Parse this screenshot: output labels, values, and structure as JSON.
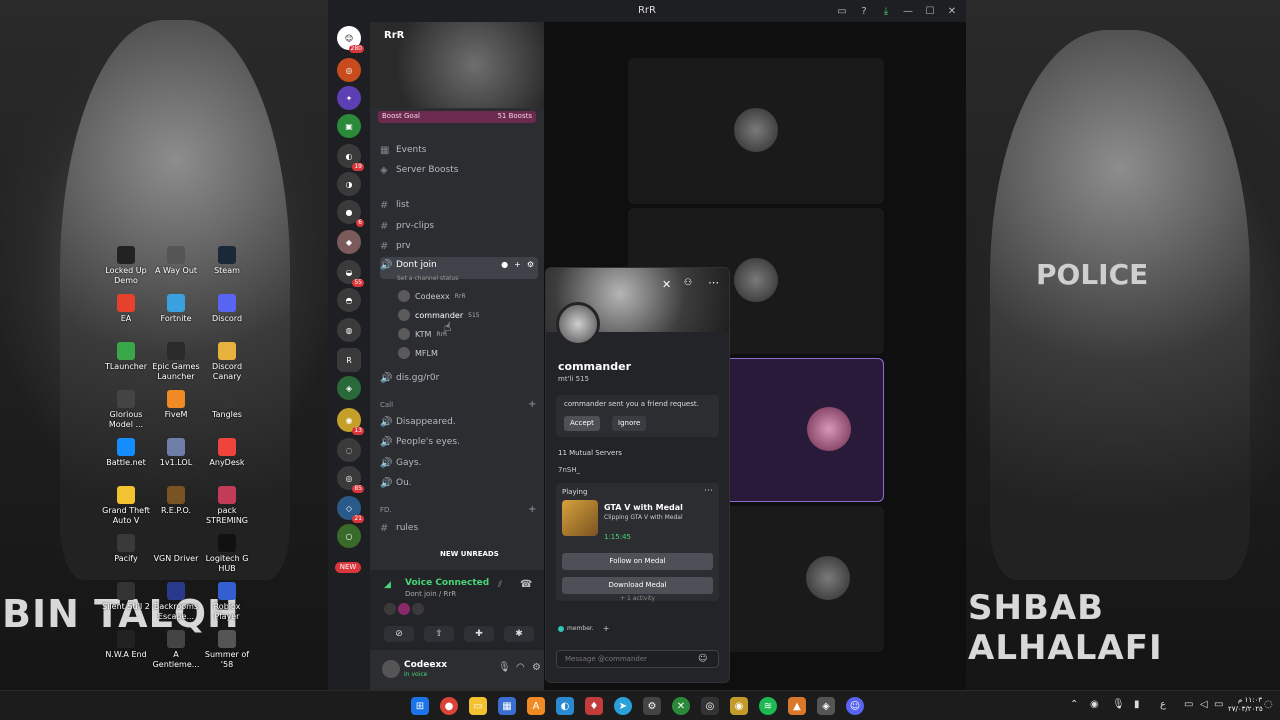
{
  "window": {
    "title": "RrR"
  },
  "server": {
    "name": "RrR",
    "boost_label": "Boost Goal",
    "boost_count": "51 Boosts"
  },
  "channels": {
    "events": "Events",
    "server_boosts": "Server Boosts",
    "list": "list",
    "prv_clips": "prv-clips",
    "prv": "prv",
    "dont_join": "Dont join",
    "status_hint": "Set a channel status",
    "invite": "dis.gg/r0r",
    "call_category": "Call",
    "disappeared": "Disappeared.",
    "peoples_eyes": "People's eyes.",
    "gays": "Gays.",
    "ou": "Ou.",
    "fd_category": "FD.",
    "rules": "rules",
    "new_unreads": "NEW UNREADS"
  },
  "voice_users": [
    {
      "name": "Codeexx",
      "tag": "RrR"
    },
    {
      "name": "commander",
      "tag": "515"
    },
    {
      "name": "KTM",
      "tag": "RrR"
    },
    {
      "name": "MFLM",
      "tag": ""
    }
  ],
  "server_badges": [
    "280",
    "19",
    "6",
    "55",
    "13",
    "85",
    "21"
  ],
  "new_badge": "NEW",
  "voice_panel": {
    "title": "Voice Connected",
    "subtitle": "Dont join / RrR"
  },
  "user": {
    "name": "Codeexx",
    "status": "In voice"
  },
  "profile": {
    "name": "commander",
    "tag": "mt'li  515",
    "request_text": "commander sent you a friend request.",
    "accept": "Accept",
    "ignore": "Ignore",
    "mutual": "11 Mutual Servers",
    "bio": "7nSH_",
    "activity_label": "Playing",
    "activity_title": "GTA V with Medal",
    "activity_sub": "Clipping GTA V with Medal",
    "activity_time": "1:15:45",
    "follow": "Follow on Medal",
    "download": "Download Medal",
    "more_activity": "+ 1 activity",
    "role": "member.",
    "message_placeholder": "Message @commander"
  },
  "desktop_icons": [
    "Locked Up Demo",
    "A Way Out",
    "Steam",
    "EA",
    "Fortnite",
    "Discord",
    "TLauncher",
    "Epic Games Launcher",
    "Discord Canary",
    "Glorious Model ...",
    "FiveM",
    "Tangles",
    "Battle.net",
    "1v1.LOL",
    "AnyDesk",
    "Grand Theft Auto V",
    "R.E.P.O.",
    "pack STREMING",
    "Pacify",
    "VGN Driver",
    "Logitech G HUB",
    "Silent Still 2",
    "Backrooms Escape...",
    "Roblox Player",
    "N.W.A End",
    "A Gentleme...",
    "Summer of '58"
  ],
  "wallpaper": {
    "left_text": "BIN TALQH",
    "right_text": "SHBAB ALHALAFI",
    "police": "POLICE"
  },
  "taskbar": {
    "time": "١١:٠٣ م",
    "date": "٢٧/٠٣/٢٠٢٥"
  },
  "colors": {
    "accent_green": "#48d676",
    "boost_pink": "#6b2a4e",
    "badge_red": "#da373c"
  }
}
